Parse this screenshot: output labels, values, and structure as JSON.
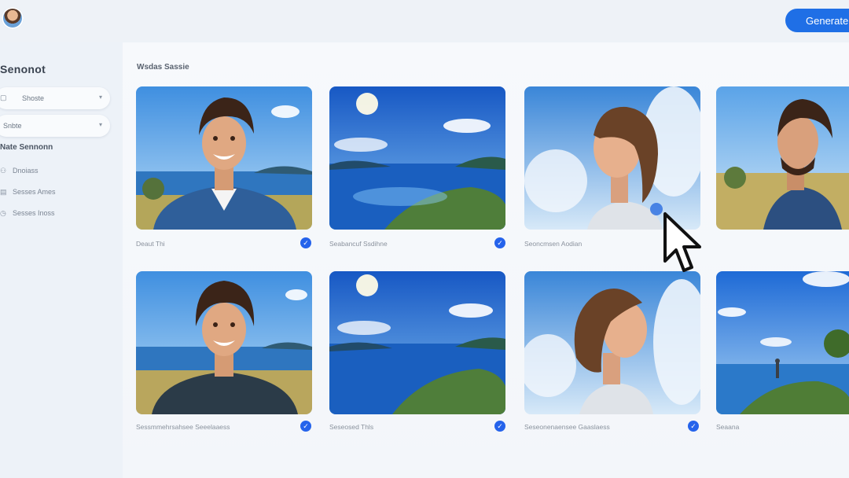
{
  "header": {
    "generate_label": "Generate"
  },
  "sidebar": {
    "title": "Senonot",
    "selects": [
      {
        "label": "Shoste"
      },
      {
        "label": "Snbte"
      }
    ],
    "section_label": "Nate Sennonn",
    "items": [
      {
        "label": "Dnoiass",
        "icon": "people-icon"
      },
      {
        "label": "Sesses Ames",
        "icon": "calendar-icon"
      },
      {
        "label": "Sesses Inoss",
        "icon": "clock-icon"
      }
    ]
  },
  "gallery": {
    "title": "Wsdas Sassie",
    "cards": [
      {
        "caption": "Deaut Thi",
        "scene": "man-smiling",
        "checked": true
      },
      {
        "caption": "Seabancuf Ssdihne",
        "scene": "ocean-sun",
        "checked": true
      },
      {
        "caption": "Seoncmsen Aodian",
        "scene": "woman-profile",
        "checked": false
      },
      {
        "caption": "",
        "scene": "man-profile",
        "checked": false
      },
      {
        "caption": "Sessmmehrsahsee Seeelaaess",
        "scene": "man-smiling",
        "checked": true
      },
      {
        "caption": "Seseosed Thls",
        "scene": "ocean-sun",
        "checked": true
      },
      {
        "caption": "Seseonenaensee Gaaslaess",
        "scene": "woman-profile",
        "checked": true
      },
      {
        "caption": "Seaana",
        "scene": "landscape-walker",
        "checked": false
      }
    ]
  },
  "colors": {
    "accent": "#1f6fe6",
    "check": "#2563eb"
  }
}
